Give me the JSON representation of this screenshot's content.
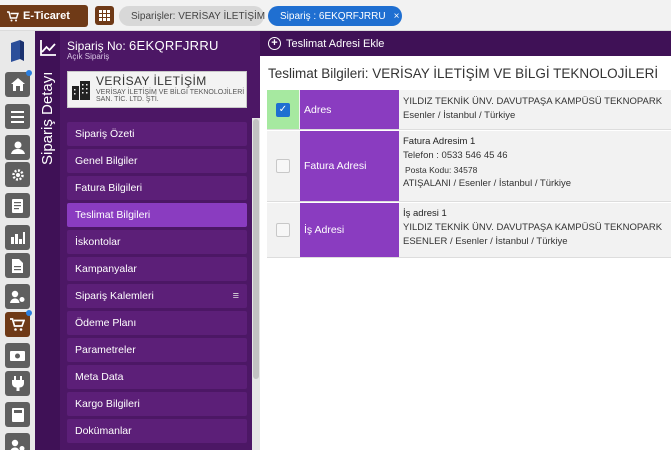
{
  "topbar": {
    "brand": "E-Ticaret",
    "tabs": [
      {
        "label": "Siparişler: VERİSAY İLETİŞİM"
      },
      {
        "label": "Sipariş : 6EKQRFJRRU",
        "close": "×"
      }
    ]
  },
  "sidebar": {
    "vertical_title": "Sipariş Detayı",
    "order_label": "Sipariş No:",
    "order_number": "6EKQRFJRRU",
    "order_status": "Açık Sipariş",
    "company_name": "VERİSAY İLETİŞİM",
    "company_sub": "VERİSAY İLETİŞİM VE BİLGİ TEKNOLOJİLERİ SAN. TİC. LTD. ŞTİ.",
    "menu": [
      {
        "label": "Sipariş Özeti"
      },
      {
        "label": "Genel Bilgiler"
      },
      {
        "label": "Fatura Bilgileri"
      },
      {
        "label": "Teslimat Bilgileri",
        "active": true
      },
      {
        "label": "İskontolar"
      },
      {
        "label": "Kampanyalar"
      },
      {
        "label": "Sipariş Kalemleri",
        "handle": "≡"
      },
      {
        "label": "Ödeme Planı"
      },
      {
        "label": "Parametreler"
      },
      {
        "label": "Meta Data"
      },
      {
        "label": "Kargo Bilgileri"
      },
      {
        "label": "Dokümanlar"
      }
    ]
  },
  "main": {
    "add_button": "Teslimat Adresi Ekle",
    "title": "Teslimat Bilgileri: VERİSAY İLETİŞİM VE BİLGİ TEKNOLOJİLERİ",
    "addresses": [
      {
        "label": "Adres",
        "checked": true,
        "lines": [
          "YILDIZ TEKNİK ÜNV. DAVUTPAŞA KAMPÜSÜ TEKNOPARK",
          "Esenler / İstanbul / Türkiye"
        ]
      },
      {
        "label": "Fatura Adresi",
        "checked": false,
        "lines": [
          "Fatura Adresim 1",
          "Telefon : 0533 546 45 46",
          "Posta Kodu: 34578",
          "ATIŞALANI / Esenler / İstanbul / Türkiye"
        ]
      },
      {
        "label": "İş Adresi",
        "checked": false,
        "lines": [
          "İş adresi 1",
          "YILDIZ TEKNİK ÜNV. DAVUTPAŞA KAMPÜSÜ TEKNOPARK",
          "ESENLER / Esenler / İstanbul / Türkiye"
        ]
      }
    ]
  },
  "colors": {
    "brand": "#6f3a17",
    "sidebar": "#4c1765",
    "accent_purple": "#8a3cc0",
    "tab_active": "#1f6fd1",
    "check_bg": "#a6e9a0"
  },
  "icons": [
    "cart-icon",
    "grid-icon",
    "chart-line-icon",
    "home-icon",
    "list-icon",
    "user-icon",
    "gear-icon",
    "document-icon",
    "chart-bar-icon",
    "file-icon",
    "user-settings-icon",
    "shopping-cart-icon",
    "money-icon",
    "plug-icon",
    "calculator-icon",
    "users-icon",
    "building-icon",
    "plus-circle-icon",
    "check-icon"
  ]
}
